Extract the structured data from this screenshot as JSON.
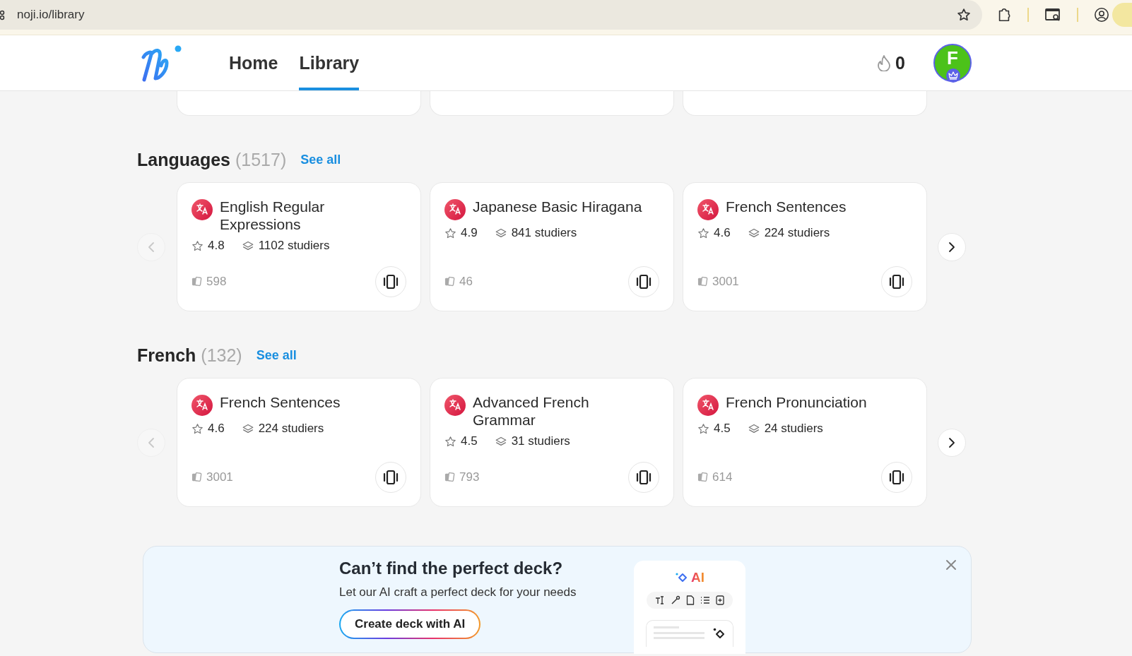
{
  "browser": {
    "url": "noji.io/library"
  },
  "nav": {
    "tabs": [
      {
        "label": "Home",
        "selected": false
      },
      {
        "label": "Library",
        "selected": true
      }
    ],
    "streak": "0",
    "avatar_letter": "F"
  },
  "sections": [
    {
      "title": "Languages",
      "count": "(1517)",
      "see_all": "See all",
      "prev_arrow": {
        "disabled": true
      },
      "next_arrow": {
        "disabled": false
      },
      "cards": [
        {
          "title": "English Regular Expressions",
          "rating": "4.8",
          "studiers": "1102 studiers",
          "card_count": "598"
        },
        {
          "title": "Japanese Basic Hiragana",
          "rating": "4.9",
          "studiers": "841 studiers",
          "card_count": "46"
        },
        {
          "title": "French Sentences",
          "rating": "4.6",
          "studiers": "224 studiers",
          "card_count": "3001"
        }
      ]
    },
    {
      "title": "French",
      "count": "(132)",
      "see_all": "See all",
      "prev_arrow": {
        "disabled": true
      },
      "next_arrow": {
        "disabled": false
      },
      "cards": [
        {
          "title": "French Sentences",
          "rating": "4.6",
          "studiers": "224 studiers",
          "card_count": "3001"
        },
        {
          "title": "Advanced French Grammar",
          "rating": "4.5",
          "studiers": "31 studiers",
          "card_count": "793"
        },
        {
          "title": "French Pronunciation",
          "rating": "4.5",
          "studiers": "24 studiers",
          "card_count": "614"
        }
      ]
    }
  ],
  "banner": {
    "title": "Can’t find the perfect deck?",
    "subtitle": "Let our AI craft a perfect deck for your needs",
    "button": "Create deck with AI",
    "preview_label": "AI"
  }
}
